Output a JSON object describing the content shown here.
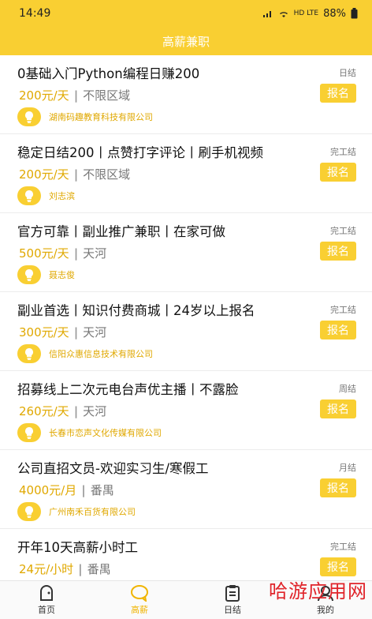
{
  "status": {
    "time": "14:49",
    "network": "HD LTE",
    "battery": "88%"
  },
  "header": {
    "title": "高薪兼职"
  },
  "jobs": [
    {
      "title": "0基础入门Python编程日赚200",
      "settle": "日结",
      "salary": "200元/天",
      "area": "不限区域",
      "apply": "报名",
      "company": "湖南码趣教育科技有限公司"
    },
    {
      "title": "稳定日结200丨点赞打字评论丨刷手机视频",
      "settle": "完工结",
      "salary": "200元/天",
      "area": "不限区域",
      "apply": "报名",
      "company": "刘志滨"
    },
    {
      "title": "官方可靠丨副业推广兼职丨在家可做",
      "settle": "完工结",
      "salary": "500元/天",
      "area": "天河",
      "apply": "报名",
      "company": "聂志俊"
    },
    {
      "title": "副业首选丨知识付费商城丨24岁以上报名",
      "settle": "完工结",
      "salary": "300元/天",
      "area": "天河",
      "apply": "报名",
      "company": "信阳众惠信息技术有限公司"
    },
    {
      "title": "招募线上二次元电台声优主播丨不露脸",
      "settle": "周结",
      "salary": "260元/天",
      "area": "天河",
      "apply": "报名",
      "company": "长春市恋声文化传媒有限公司"
    },
    {
      "title": "公司直招文员-欢迎实习生/寒假工",
      "settle": "月结",
      "salary": "4000元/月",
      "area": "番禺",
      "apply": "报名",
      "company": "广州南禾百货有限公司"
    },
    {
      "title": "开年10天高薪小时工",
      "settle": "完工结",
      "salary": "24元/小时",
      "area": "番禺",
      "apply": "报名",
      "company": ""
    }
  ],
  "tabs": [
    {
      "label": "首页",
      "icon": "home-icon"
    },
    {
      "label": "高薪",
      "icon": "chat-bubble-icon"
    },
    {
      "label": "日结",
      "icon": "clipboard-icon"
    },
    {
      "label": "我的",
      "icon": "user-icon"
    }
  ],
  "watermark": "哈游应用网",
  "colors": {
    "accent": "#f9cf32",
    "salary": "#e0a800",
    "watermark": "#e0242a"
  }
}
